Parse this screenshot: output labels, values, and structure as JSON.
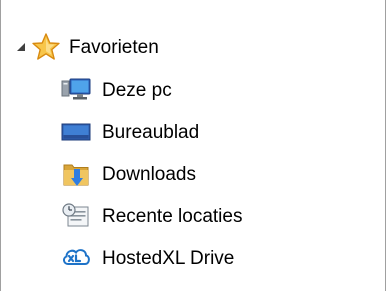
{
  "navigation_pane": {
    "favorites": {
      "label": "Favorieten",
      "expander_icon": "expanded-triangle-icon",
      "icon": "star-icon"
    },
    "items": [
      {
        "label": "Deze pc",
        "icon": "computer-icon"
      },
      {
        "label": "Bureaublad",
        "icon": "desktop-icon"
      },
      {
        "label": "Downloads",
        "icon": "downloads-folder-icon"
      },
      {
        "label": "Recente locaties",
        "icon": "recent-places-icon"
      },
      {
        "label": "HostedXL Drive",
        "icon": "hostedxl-drive-icon"
      }
    ]
  },
  "colors": {
    "star_fill": "#f8c64a",
    "star_stroke": "#d88a10",
    "folder": "#e8b84a",
    "download_arrow": "#2f7de1",
    "desktop": "#2f5fb0",
    "cloud": "#1e73c8"
  }
}
